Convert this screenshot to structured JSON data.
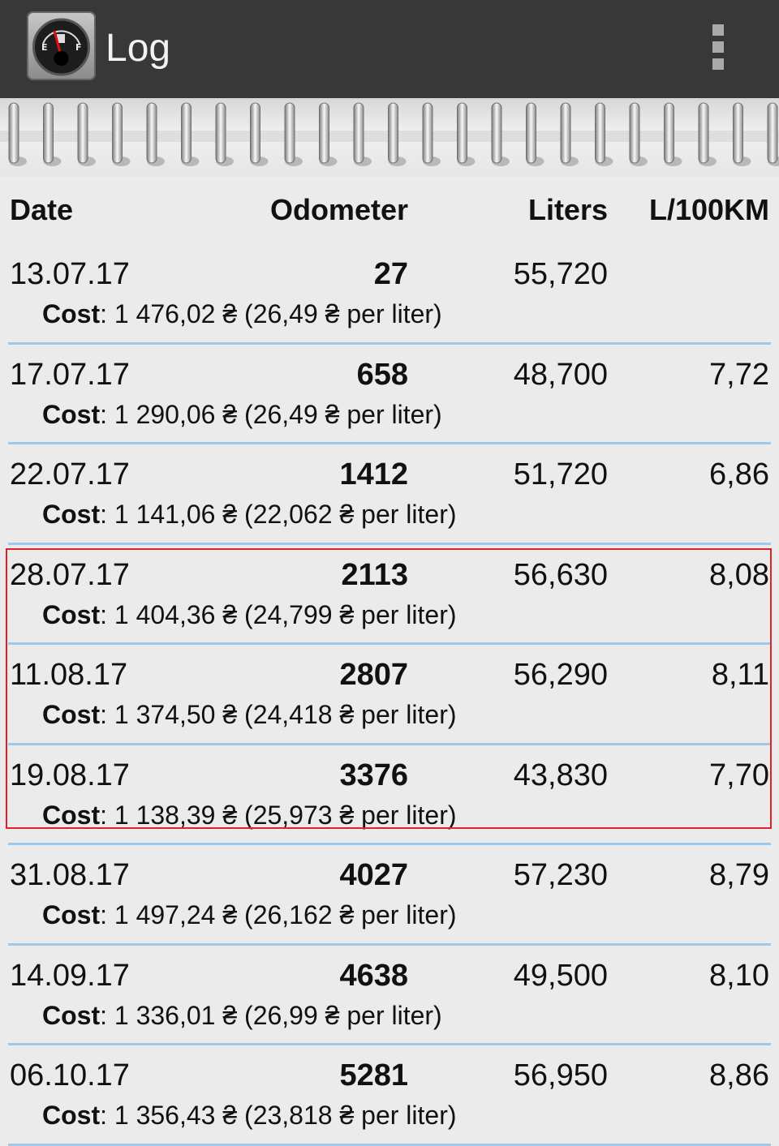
{
  "appbar": {
    "title": "Log",
    "icon": "fuel-gauge-icon",
    "menu_icon": "overflow-menu-icon"
  },
  "columns": {
    "date": "Date",
    "odometer": "Odometer",
    "liters": "Liters",
    "consumption": "L/100KM"
  },
  "cost_label": "Cost",
  "entries": [
    {
      "date": "13.07.17",
      "odometer": "27",
      "liters": "55,720",
      "consumption": "",
      "cost": ": 1 476,02 ₴ (26,49 ₴ per liter)"
    },
    {
      "date": "17.07.17",
      "odometer": "658",
      "liters": "48,700",
      "consumption": "7,72",
      "cost": ": 1 290,06 ₴ (26,49 ₴ per liter)"
    },
    {
      "date": "22.07.17",
      "odometer": "1412",
      "liters": "51,720",
      "consumption": "6,86",
      "cost": ": 1 141,06 ₴ (22,062 ₴ per liter)"
    },
    {
      "date": "28.07.17",
      "odometer": "2113",
      "liters": "56,630",
      "consumption": "8,08",
      "cost": ": 1 404,36 ₴ (24,799 ₴ per liter)"
    },
    {
      "date": "11.08.17",
      "odometer": "2807",
      "liters": "56,290",
      "consumption": "8,11",
      "cost": ": 1 374,50 ₴ (24,418 ₴ per liter)"
    },
    {
      "date": "19.08.17",
      "odometer": "3376",
      "liters": "43,830",
      "consumption": "7,70",
      "cost": ": 1 138,39 ₴ (25,973 ₴ per liter)"
    },
    {
      "date": "31.08.17",
      "odometer": "4027",
      "liters": "57,230",
      "consumption": "8,79",
      "cost": ": 1 497,24 ₴ (26,162 ₴ per liter)"
    },
    {
      "date": "14.09.17",
      "odometer": "4638",
      "liters": "49,500",
      "consumption": "8,10",
      "cost": ": 1 336,01 ₴ (26,99 ₴ per liter)"
    },
    {
      "date": "06.10.17",
      "odometer": "5281",
      "liters": "56,950",
      "consumption": "8,86",
      "cost": ": 1 356,43 ₴ (23,818 ₴ per liter)"
    }
  ],
  "colors": {
    "appbar": "#383838",
    "background": "#ebebeb",
    "divider": "#9cc9ee",
    "highlight": "#e0202a"
  }
}
